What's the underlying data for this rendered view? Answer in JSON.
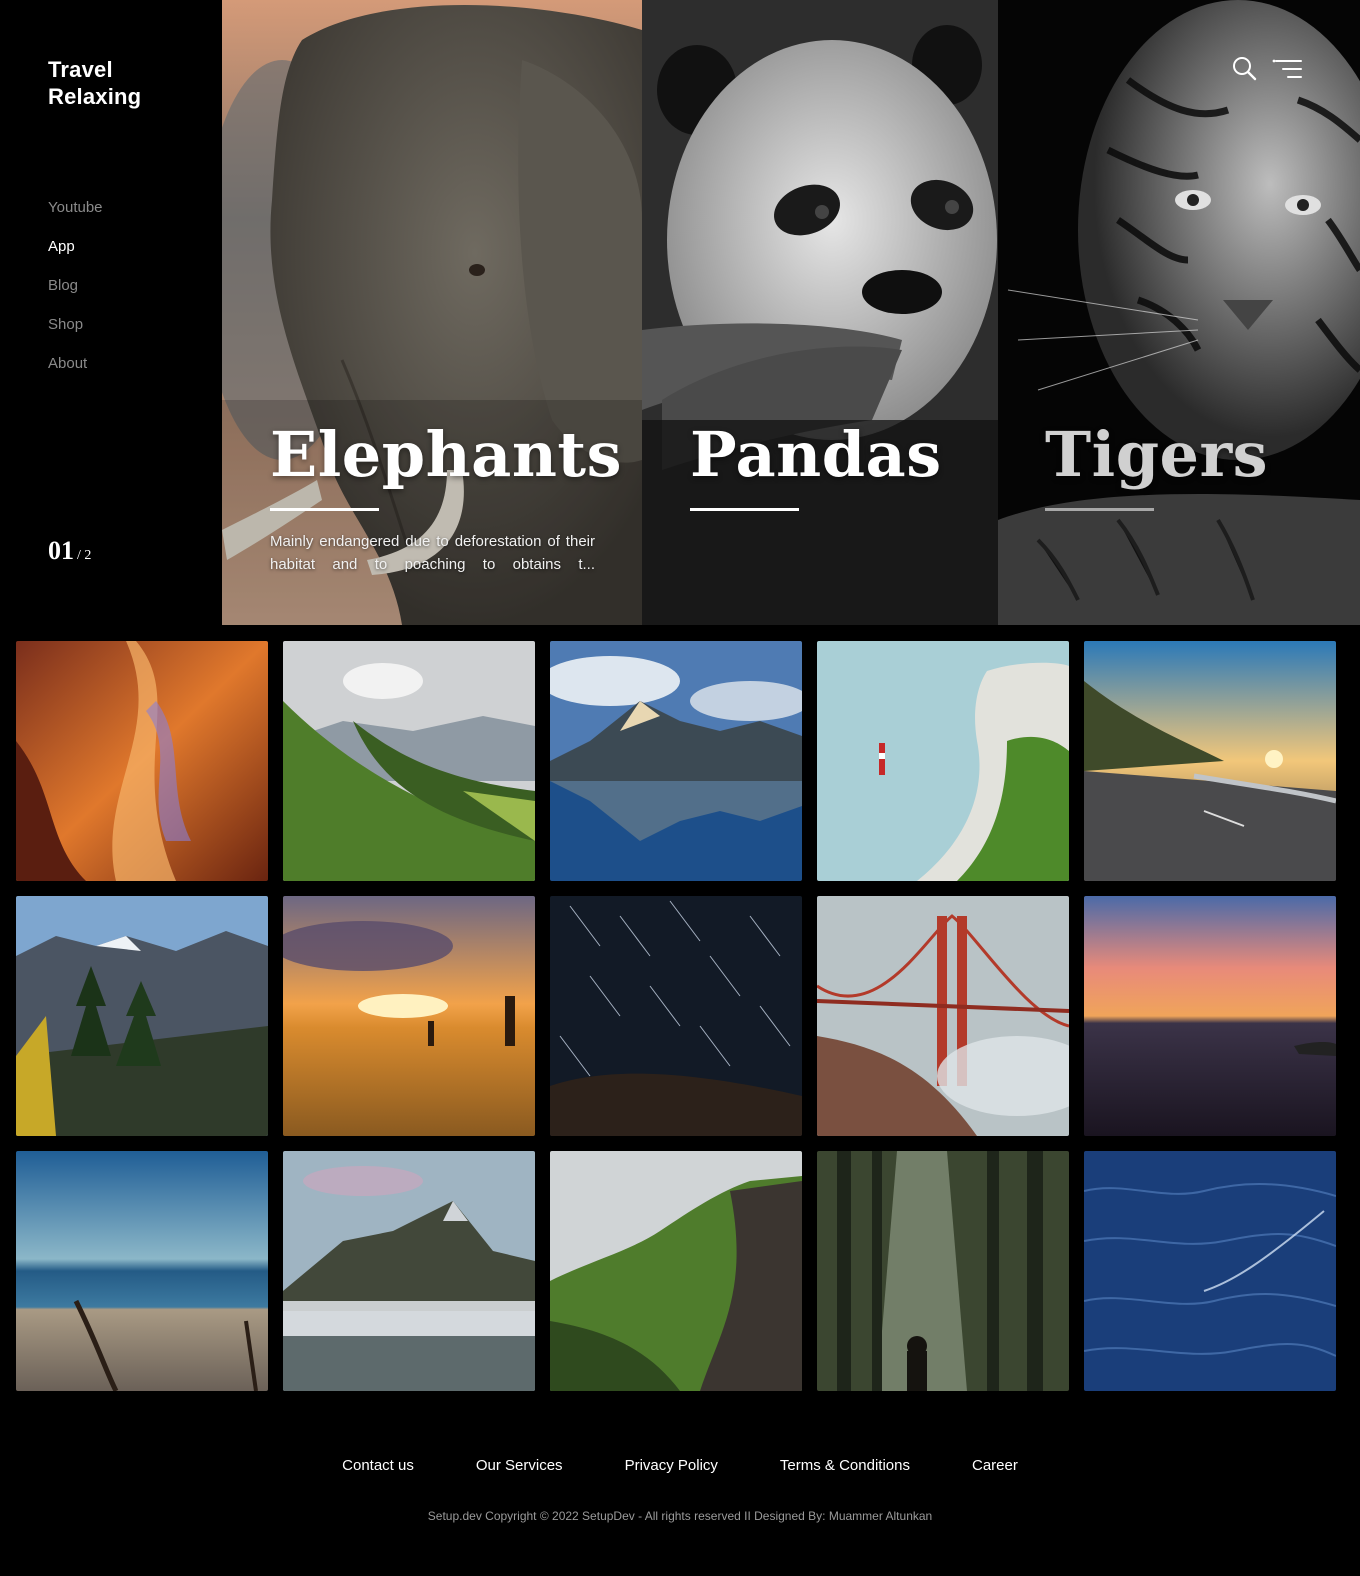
{
  "brand": {
    "line1": "Travel",
    "line2": "Relaxing"
  },
  "nav": [
    {
      "label": "Youtube",
      "active": false
    },
    {
      "label": "App",
      "active": true
    },
    {
      "label": "Blog",
      "active": false
    },
    {
      "label": "Shop",
      "active": false
    },
    {
      "label": "About",
      "active": false
    }
  ],
  "slider": {
    "current": "01",
    "separator": "/",
    "total": "2"
  },
  "panels": [
    {
      "title": "Elephants",
      "description": "Mainly endangered due to deforestation of their habitat and to poaching to obtains t..."
    },
    {
      "title": "Pandas"
    },
    {
      "title": "Tigers"
    }
  ],
  "header_icons": [
    "search-icon",
    "menu-icon"
  ],
  "gallery": [
    "canyon-photo",
    "green-valley-photo",
    "mountain-lake-photo",
    "lighthouse-cliff-photo",
    "coastal-road-photo",
    "alpine-hikers-photo",
    "sunset-field-photo",
    "star-trails-photo",
    "golden-gate-photo",
    "ocean-sunset-photo",
    "beach-photo",
    "misty-peak-photo",
    "green-cliffs-photo",
    "forest-light-photo",
    "ocean-water-photo"
  ],
  "footer": {
    "links": [
      "Contact us",
      "Our Services",
      "Privacy Policy",
      "Terms & Conditions",
      "Career"
    ],
    "copyright": "Setup.dev Copyright © 2022 SetupDev - All rights reserved II Designed By: Muammer Altunkan"
  }
}
